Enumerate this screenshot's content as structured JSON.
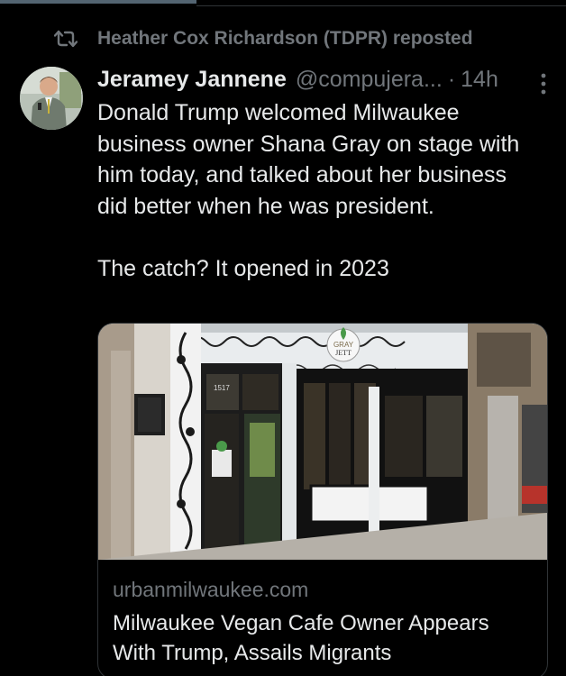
{
  "repost": {
    "text": "Heather Cox Richardson (TDPR) reposted",
    "icon": "repost-icon"
  },
  "tweet": {
    "author_name": "Jeramey Jannene",
    "handle": "@compujera...",
    "separator": "·",
    "time": "14h",
    "text": "Donald Trump welcomed Milwaukee business owner Shana Gray on stage with him today, and talked about her business did better when he was president.\n\nThe catch? It opened in 2023",
    "more_icon": "more-icon"
  },
  "card": {
    "domain": "urbanmilwaukee.com",
    "title": "Milwaukee Vegan Cafe Owner Appears With Trump, Assails Migrants",
    "image_logo_line1": "GRAY",
    "image_logo_line2": "JETT",
    "storefront_number": "1517"
  },
  "colors": {
    "background": "#000000",
    "text_primary": "#e7e9ea",
    "text_secondary": "#71767b",
    "border": "#2f3336"
  }
}
